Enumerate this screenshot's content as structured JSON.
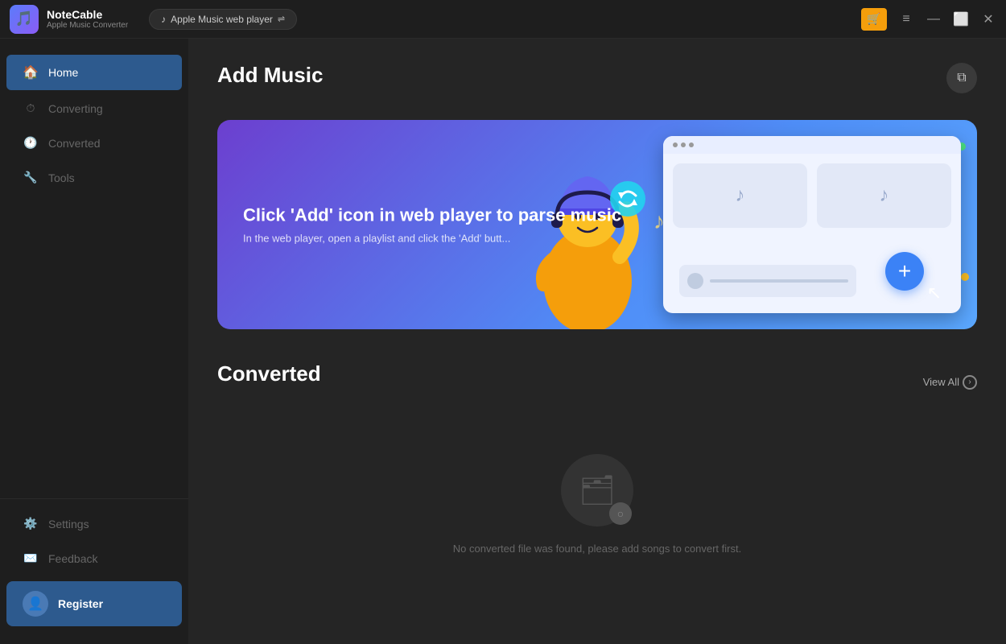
{
  "app": {
    "name": "NoteCable",
    "subtitle": "Apple Music Converter",
    "logo_icon": "🎵"
  },
  "titlebar": {
    "tab_label": "Apple Music web player",
    "tab_icon": "♪",
    "cart_icon": "🛒",
    "menu_icon": "≡",
    "minimize_icon": "—",
    "maximize_icon": "⬜",
    "close_icon": "✕"
  },
  "sidebar": {
    "items": [
      {
        "id": "home",
        "label": "Home",
        "icon": "🏠",
        "active": true
      },
      {
        "id": "converting",
        "label": "Converting",
        "icon": "⏱"
      },
      {
        "id": "converted",
        "label": "Converted",
        "icon": "🕐"
      },
      {
        "id": "tools",
        "label": "Tools",
        "icon": "🔧"
      }
    ],
    "bottom_items": [
      {
        "id": "settings",
        "label": "Settings",
        "icon": "⚙️"
      },
      {
        "id": "feedback",
        "label": "Feedback",
        "icon": "✉️"
      }
    ],
    "register": {
      "label": "Register",
      "icon": "👤"
    }
  },
  "content": {
    "add_music": {
      "title": "Add Music",
      "banner": {
        "heading": "Click 'Add' icon in web player to parse music",
        "subtext": "In the web player, open a playlist and click the 'Add' butt..."
      }
    },
    "converted": {
      "title": "Converted",
      "view_all": "View All",
      "empty_text": "No converted file was found, please add songs to convert first."
    }
  }
}
